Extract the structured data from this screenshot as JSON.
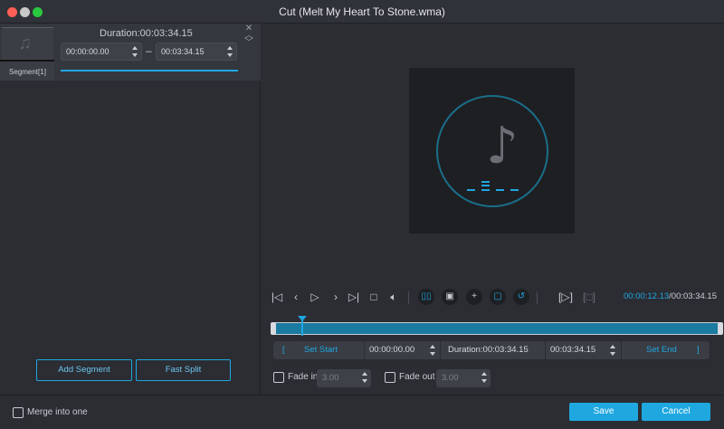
{
  "window": {
    "title": "Cut (Melt My Heart To Stone.wma)"
  },
  "segment": {
    "label": "Segment[1]",
    "duration": "Duration:00:03:34.15",
    "start_time": "00:00:00.00",
    "end_time": "00:03:34.15",
    "dash": "–"
  },
  "left_buttons": {
    "add_segment": "Add Segment",
    "fast_split": "Fast Split"
  },
  "playback": {
    "current_time": "00:00:12.13",
    "total_time": "/00:03:34.15"
  },
  "setbar": {
    "open_bracket": "[",
    "set_start": "Set Start",
    "start_value": "00:00:00.00",
    "duration": "Duration:00:03:34.15",
    "end_value": "00:03:34.15",
    "set_end": "Set End",
    "close_bracket": "]"
  },
  "fade": {
    "fade_in_label": "Fade in",
    "fade_in_value": "3.00",
    "fade_out_label": "Fade out",
    "fade_out_value": "3.00"
  },
  "bottom": {
    "merge_label": "Merge into one",
    "save": "Save",
    "cancel": "Cancel"
  },
  "colors": {
    "accent": "#1fa7e0",
    "background": "#2b2d33"
  }
}
